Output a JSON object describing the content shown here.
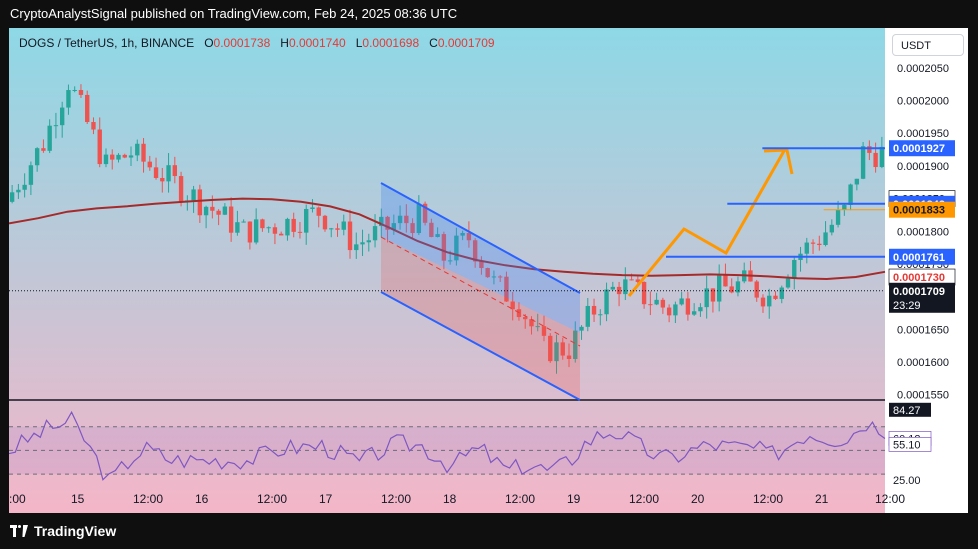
{
  "publisher_line": "CryptoAnalystSignal published on TradingView.com, Feb 24, 2025 08:36 UTC",
  "symbol": {
    "title": "DOGS / TetherUS, 1h, BINANCE",
    "o_label": "O",
    "o_value": "0.0001738",
    "h_label": "H",
    "h_value": "0.0001740",
    "l_label": "L",
    "l_value": "0.0001698",
    "c_label": "C",
    "c_value": "0.0001709"
  },
  "currency_button": "USDT",
  "brand": "TradingView",
  "colors": {
    "up": "#26a69a",
    "down": "#ef5350",
    "ma": "#a52a2a",
    "level": "#2962ff",
    "orange": "#ff9800",
    "rsi": "#7e57c2",
    "bg_top": "#8ed8e6",
    "bg_bottom": "#f4b6c8"
  },
  "chart_data": [
    {
      "type": "candlestick",
      "x_ticks": [
        ":00",
        "15",
        "12:00",
        "16",
        "12:00",
        "17",
        "12:00",
        "18",
        "12:00",
        "19",
        "12:00",
        "20",
        "12:00",
        "21",
        "12:00"
      ],
      "y_ticks": [
        "0.0002050",
        "0.0002000",
        "0.0001950",
        "0.0001900",
        "0.0001850",
        "0.0001800",
        "0.0001750",
        "0.0001700",
        "0.0001650",
        "0.0001600",
        "0.0001550"
      ],
      "ylim": [
        0.0001545,
        0.0002065
      ],
      "price_labels": [
        {
          "text": "0.0001927",
          "value": 0.0001927,
          "style": "blue"
        },
        {
          "text": "0.0001850",
          "value": 0.000185,
          "style": "white"
        },
        {
          "text": "0.0001842",
          "value": 0.0001842,
          "style": "blue"
        },
        {
          "text": "0.0001833",
          "value": 0.0001833,
          "style": "orange"
        },
        {
          "text": "0.0001761",
          "value": 0.0001761,
          "style": "blue"
        },
        {
          "text": "0.0001730",
          "value": 0.000173,
          "style": "red"
        },
        {
          "text": "0.0001709",
          "value": 0.0001709,
          "style": "black",
          "sub": "23:29"
        }
      ],
      "levels": [
        {
          "value": 0.0001927,
          "x_from": 0.86,
          "x_to": 1.0
        },
        {
          "value": 0.0001842,
          "x_from": 0.82,
          "x_to": 1.0
        },
        {
          "value": 0.0001761,
          "x_from": 0.75,
          "x_to": 1.0
        },
        {
          "value": 0.0001833,
          "x_from": 0.93,
          "x_to": 1.0,
          "color": "orange"
        }
      ],
      "series": [
        {
          "name": "MA",
          "values": [
            0.0001812,
            0.000182,
            0.000183,
            0.0001835,
            0.0001838,
            0.0001842,
            0.0001845,
            0.0001848,
            0.000185,
            0.0001849,
            0.0001845,
            0.0001838,
            0.0001826,
            0.0001806,
            0.0001785,
            0.0001768,
            0.0001756,
            0.0001748,
            0.0001742,
            0.0001738,
            0.0001735,
            0.0001733,
            0.0001732,
            0.0001733,
            0.0001734,
            0.0001733,
            0.0001731,
            0.0001728,
            0.0001727,
            0.000173,
            0.0001738
          ]
        }
      ]
    },
    {
      "type": "line",
      "name": "RSI",
      "y_ticks": [
        "84.27",
        "60.12",
        "55.10",
        "25.00"
      ],
      "ylim": [
        20,
        90
      ]
    }
  ]
}
